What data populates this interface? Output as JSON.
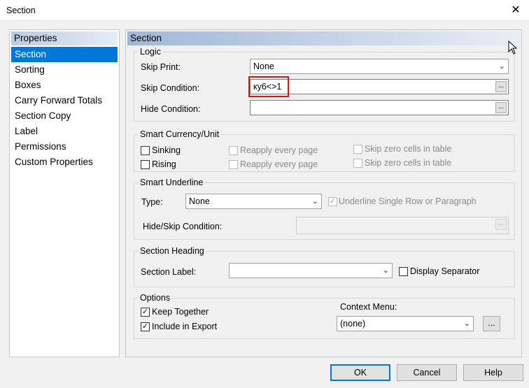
{
  "window": {
    "title": "Section",
    "close_glyph": "✕"
  },
  "sidebar": {
    "header": "Properties",
    "items": [
      {
        "label": "Section"
      },
      {
        "label": "Sorting"
      },
      {
        "label": "Boxes"
      },
      {
        "label": "Carry Forward Totals"
      },
      {
        "label": "Section Copy"
      },
      {
        "label": "Label"
      },
      {
        "label": "Permissions"
      },
      {
        "label": "Custom Properties"
      }
    ]
  },
  "main": {
    "header": "Section"
  },
  "logic": {
    "title": "Logic",
    "skip_print_label": "Skip Print:",
    "skip_print_value": "None",
    "skip_condition_label": "Skip Condition:",
    "skip_condition_value": "ку6<>1",
    "hide_condition_label": "Hide Condition:",
    "hide_condition_value": "",
    "dots": "..."
  },
  "smart_currency": {
    "title": "Smart Currency/Unit",
    "sinking": "Sinking",
    "rising": "Rising",
    "reapply1": "Reapply every page",
    "reapply2": "Reapply every page",
    "skipzero1": "Skip zero cells in table",
    "skipzero2": "Skip zero cells in table"
  },
  "smart_underline": {
    "title": "Smart Underline",
    "type_label": "Type:",
    "type_value": "None",
    "underline_single": "Underline Single Row or Paragraph",
    "hide_skip_label": "Hide/Skip Condition:"
  },
  "section_heading": {
    "title": "Section Heading",
    "section_label": "Section Label:",
    "section_label_value": "",
    "display_separator": "Display Separator"
  },
  "options": {
    "title": "Options",
    "keep_together": "Keep Together",
    "include_export": "Include in Export",
    "context_menu_label": "Context Menu:",
    "context_menu_value": "(none)"
  },
  "buttons": {
    "ok": "OK",
    "cancel": "Cancel",
    "help": "Help"
  },
  "glyphs": {
    "check": "✓",
    "arrow": "⌄"
  }
}
